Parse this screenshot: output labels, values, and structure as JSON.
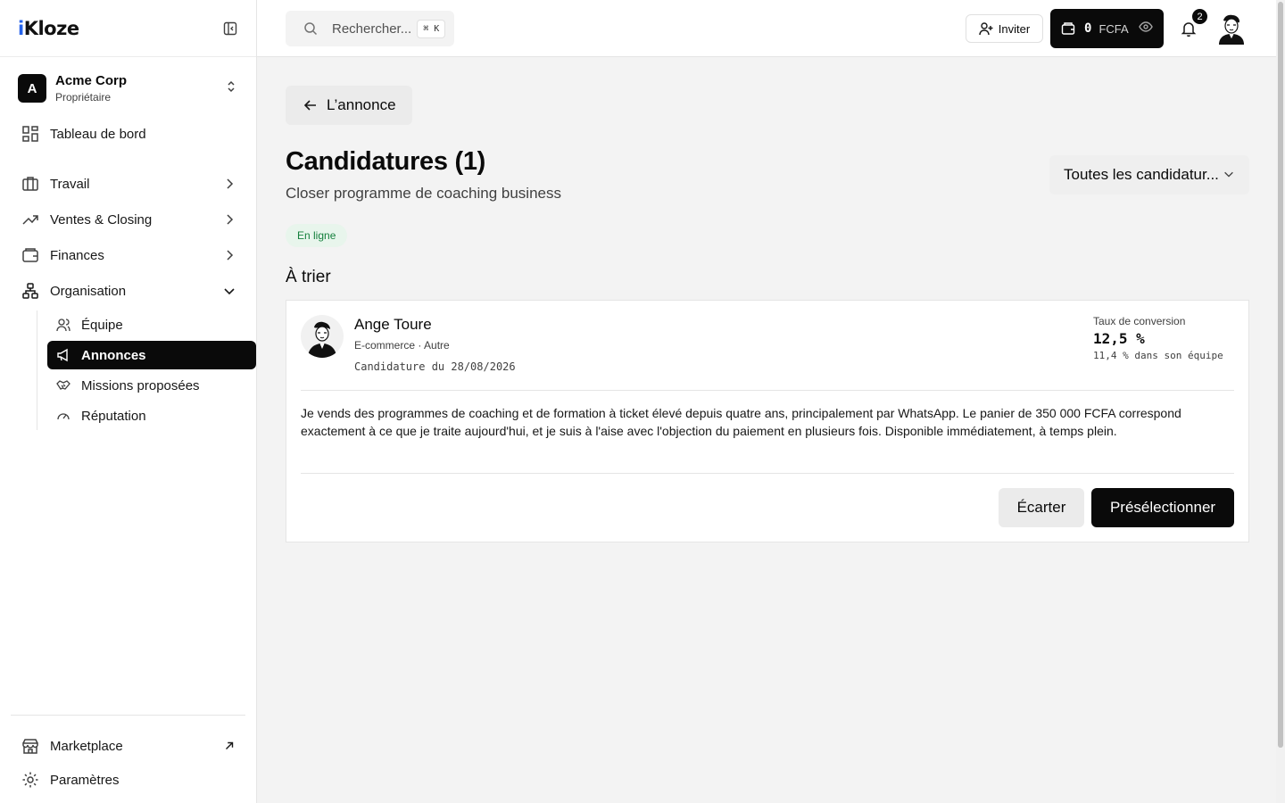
{
  "app": {
    "logo_text_i": "i",
    "logo_text_rest": "Kloze"
  },
  "org": {
    "initial": "A",
    "name": "Acme Corp",
    "role": "Propriétaire"
  },
  "nav": {
    "dashboard": "Tableau de bord",
    "work": "Travail",
    "sales": "Ventes & Closing",
    "finances": "Finances",
    "organisation": "Organisation",
    "sub": {
      "team": "Équipe",
      "ads": "Annonces",
      "missions": "Missions proposées",
      "reputation": "Réputation"
    },
    "marketplace": "Marketplace",
    "settings": "Paramètres"
  },
  "topbar": {
    "search_placeholder": "Rechercher...",
    "search_shortcut": "⌘ K",
    "invite": "Inviter",
    "wallet_amount": "0",
    "wallet_currency": "FCFA",
    "notifications_count": "2"
  },
  "page": {
    "back_label": "L’annonce",
    "title": "Candidatures (1)",
    "subtitle": "Closer programme de coaching business",
    "filter_value": "Toutes les candidatur...",
    "status": "En ligne",
    "section": "À trier"
  },
  "candidate": {
    "name": "Ange Toure",
    "meta": "E-commerce · Autre",
    "date": "Candidature du 28/08/2026",
    "rate_label": "Taux de conversion",
    "rate_value": "12,5 %",
    "rate_team": "11,4 % dans son équipe",
    "message": "Je vends des programmes de coaching et de formation à ticket élevé depuis quatre ans, principalement par WhatsApp. Le panier de 350 000 FCFA correspond exactement à ce que je traite aujourd'hui, et je suis à l'aise avec l'objection du paiement en plusieurs fois. Disponible immédiatement, à temps plein.",
    "discard": "Écarter",
    "shortlist": "Présélectionner"
  },
  "colors": {
    "accent": "#0a0a0a",
    "logo_accent": "#2563eb",
    "status_green": "#15803d",
    "status_bg": "#e8f5ec"
  }
}
